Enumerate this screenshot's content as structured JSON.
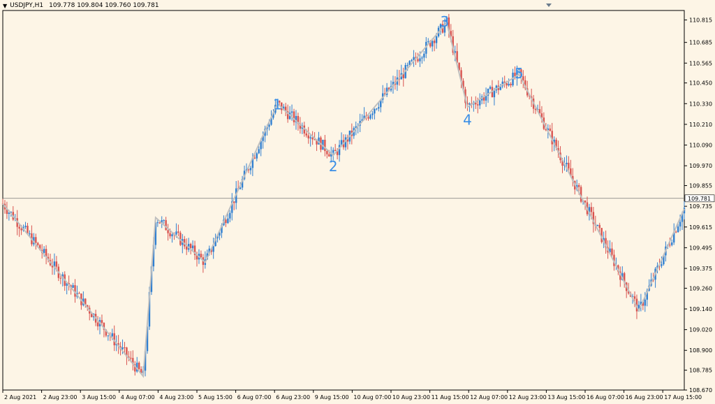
{
  "window": {
    "symbol_label": "USDJPY,H1",
    "ohlc_label": "109.778 109.804 109.760 109.781"
  },
  "chart_data": {
    "type": "candlestick",
    "symbol": "USDJPY",
    "timeframe": "H1",
    "current_price": "109.781",
    "ylim": [
      108.67,
      110.87
    ],
    "y_ticks": [
      "110.815",
      "110.685",
      "110.565",
      "110.450",
      "110.330",
      "110.210",
      "110.090",
      "109.970",
      "109.855",
      "109.735",
      "109.615",
      "109.495",
      "109.375",
      "109.260",
      "109.140",
      "109.020",
      "108.900",
      "108.785",
      "108.670"
    ],
    "x_ticks": [
      "2 Aug 2021",
      "2 Aug 23:00",
      "3 Aug 15:00",
      "4 Aug 07:00",
      "4 Aug 23:00",
      "5 Aug 15:00",
      "6 Aug 07:00",
      "6 Aug 23:00",
      "9 Aug 15:00",
      "10 Aug 07:00",
      "10 Aug 23:00",
      "11 Aug 15:00",
      "12 Aug 07:00",
      "12 Aug 23:00",
      "13 Aug 15:00",
      "16 Aug 07:00",
      "16 Aug 23:00",
      "17 Aug 15:00"
    ],
    "x_range": [
      0,
      330
    ],
    "zigzag": [
      {
        "x": 0,
        "y": 109.75
      },
      {
        "x": 68,
        "y": 108.75
      },
      {
        "x": 74,
        "y": 109.67
      },
      {
        "x": 98,
        "y": 109.41
      },
      {
        "x": 133,
        "y": 110.33
      },
      {
        "x": 160,
        "y": 110.03
      },
      {
        "x": 215,
        "y": 110.8
      },
      {
        "x": 225,
        "y": 110.31
      },
      {
        "x": 250,
        "y": 110.5
      },
      {
        "x": 308,
        "y": 109.13
      },
      {
        "x": 330,
        "y": 109.72
      }
    ],
    "wave_labels": [
      {
        "text": "1",
        "x": 133,
        "y": 110.32
      },
      {
        "text": "2",
        "x": 160,
        "y": 109.96
      },
      {
        "text": "3",
        "x": 214,
        "y": 110.8
      },
      {
        "text": "4",
        "x": 225,
        "y": 110.23
      },
      {
        "text": "5",
        "x": 250,
        "y": 110.5
      }
    ],
    "colors": {
      "background": "#fdf5e6",
      "up_candle": "#2f7fd1",
      "down_candle": "#d9534f",
      "zigzag": "#bfbfbf",
      "wave_label": "#3a8ee6",
      "price_line": "#7a7a7a",
      "axis": "#000000"
    }
  }
}
